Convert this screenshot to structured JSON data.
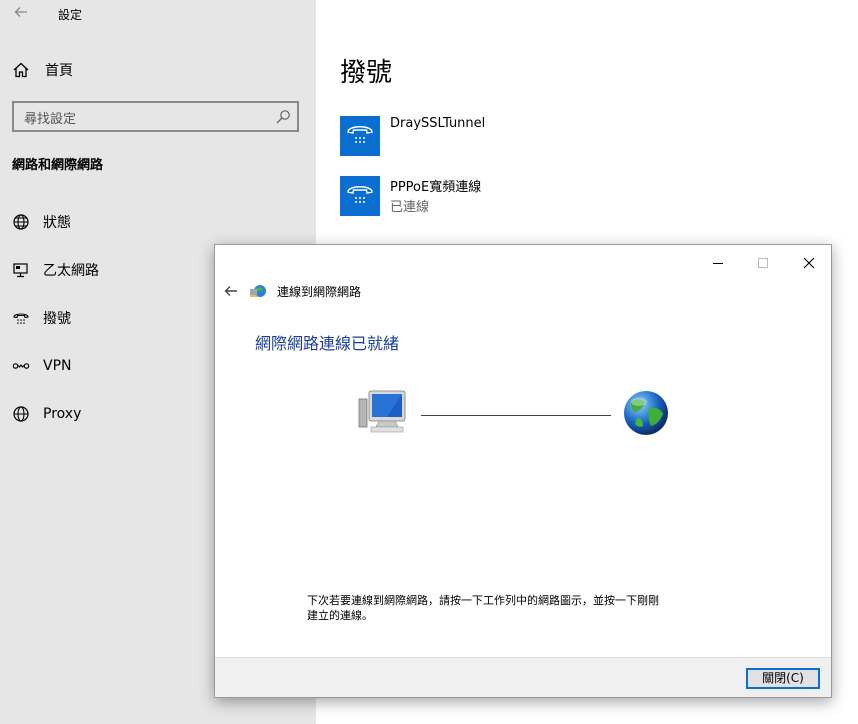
{
  "settings": {
    "title": "設定",
    "home": "首頁",
    "search_placeholder": "尋找設定",
    "section": "網路和網際網路",
    "nav": [
      {
        "label": "狀態",
        "icon": "globe-status-icon"
      },
      {
        "label": "乙太網路",
        "icon": "ethernet-icon"
      },
      {
        "label": "撥號",
        "icon": "dialup-icon"
      },
      {
        "label": "VPN",
        "icon": "vpn-icon"
      },
      {
        "label": "Proxy",
        "icon": "globe-icon"
      }
    ]
  },
  "main": {
    "title": "撥號",
    "connections": [
      {
        "name": "DraySSLTunnel",
        "status": ""
      },
      {
        "name": "PPPoE寬頻連線",
        "status": "已連線"
      }
    ]
  },
  "dialog": {
    "header_title": "連線到網際網路",
    "heading": "網際網路連線已就緒",
    "hint": "下次若要連線到網際網路，請按一下工作列中的網路圖示，並按一下剛剛建立的連線。",
    "close_label": "關閉(C)"
  },
  "colors": {
    "accent": "#0a6fd1",
    "sidebar_bg": "#e6e6e6",
    "heading_blue": "#1c3f94"
  }
}
